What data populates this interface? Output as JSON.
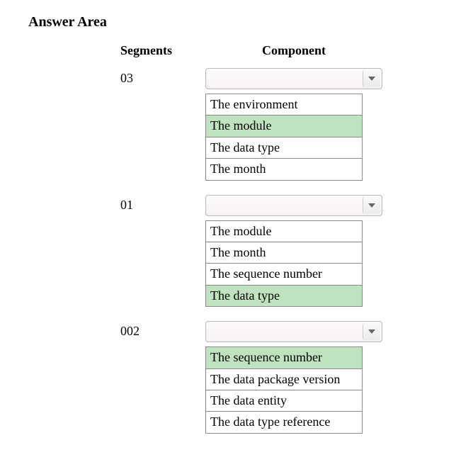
{
  "title": "Answer Area",
  "headers": {
    "segments": "Segments",
    "component": "Component"
  },
  "rows": [
    {
      "segment": "03",
      "options": [
        {
          "label": "The environment",
          "selected": false
        },
        {
          "label": "The module",
          "selected": true
        },
        {
          "label": "The data type",
          "selected": false
        },
        {
          "label": "The month",
          "selected": false
        }
      ]
    },
    {
      "segment": "01",
      "options": [
        {
          "label": "The module",
          "selected": false
        },
        {
          "label": "The month",
          "selected": false
        },
        {
          "label": "The sequence number",
          "selected": false
        },
        {
          "label": "The data type",
          "selected": true
        }
      ]
    },
    {
      "segment": "002",
      "options": [
        {
          "label": "The sequence number",
          "selected": true
        },
        {
          "label": "The data package version",
          "selected": false
        },
        {
          "label": "The data entity",
          "selected": false
        },
        {
          "label": "The data type reference",
          "selected": false
        }
      ]
    }
  ]
}
